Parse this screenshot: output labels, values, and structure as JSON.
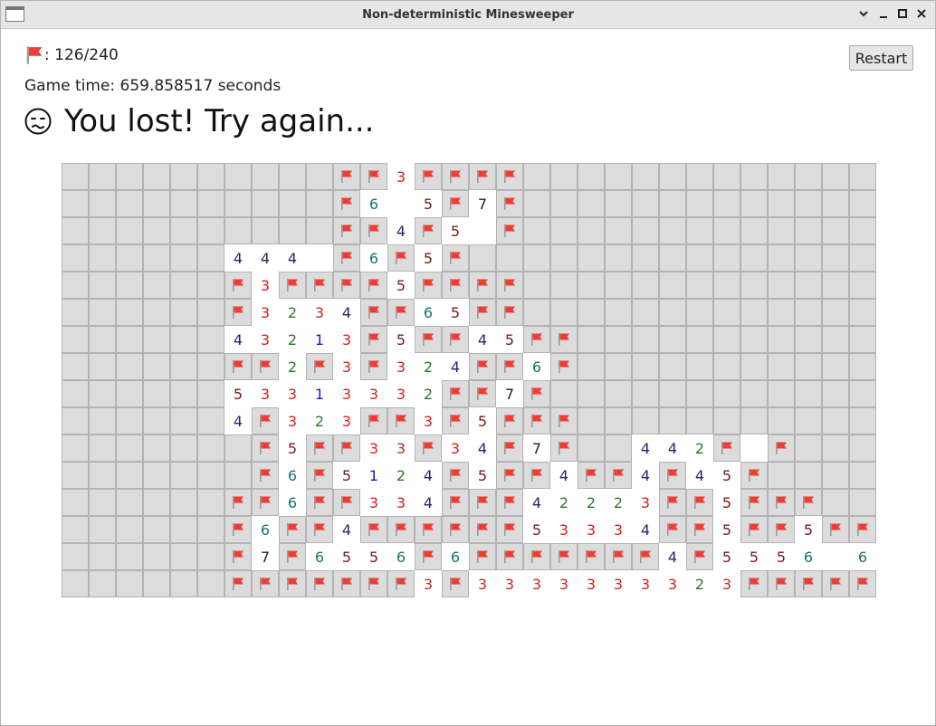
{
  "window": {
    "title": "Non-deterministic Minesweeper"
  },
  "flag_counter": {
    "icon": "flag-icon",
    "text": ": 126/240"
  },
  "game_time": "Game time: 659.858517 seconds",
  "status": {
    "icon": "sad-face-icon",
    "text": "You lost! Try again..."
  },
  "restart_label": "Restart",
  "colors": {
    "hidden": "#dcdcdc",
    "opened": "#ffffff",
    "flag": "#f03c32"
  },
  "number_colors": {
    "1": "#1a1ac8",
    "2": "#2a7a2a",
    "3": "#d42020",
    "4": "#252570",
    "5": "#7a1818",
    "6": "#1a7070",
    "7": "#222222"
  },
  "board": {
    "cols": 30,
    "rows": [
      "hhhhhhhhhhFF3FFFFhhhhhhhhhhhhh",
      "hhhhhhhhhhF6.5F7Fhhhhhhhhhhhhh",
      "hhhhhhhhhhFF4F5.Fhhhhhhhhhhhhh",
      "hhhhhh444.F6F5Fhhhhhhhhhhhhhhh",
      "hhhhhhF3FFFF5FFFFhhhhhhhhhhhhh",
      "hhhhhhF3234FF65FFhhhhhhhhhhhhh",
      "hhhhhh43213F5FF45FFhhhhhhhhhhh",
      "hhhhhhFF2F3F324FF6Fhhhhhhhhhhh",
      "hhhhhh53313332FF7Fhhhhhhhhhhhh",
      "hhhhhh4F323FF3F5FFFhhhhhhhhhhh",
      "hhhhhhhF5FF33F34F7Fhh442F.Fhhh",
      "hhhhhhhF6F5124F5FF4FF4F45Fhhhh",
      "hhhhhhFF6FF334FFF42223FF5FFFhh",
      "hhhhhhF6FF4FFFFFF53334FF5FF5FFFF",
      "hhhhhhF7F6556F6FFFFFFF4F5556 64",
      "hhhhhhFFFFFFF3F3333333323FFFFFFF"
    ]
  }
}
